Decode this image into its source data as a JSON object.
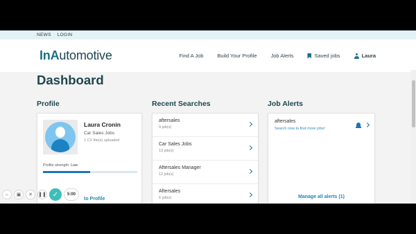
{
  "topbar": {
    "news": "NEWS",
    "login": "LOGIN"
  },
  "logo": {
    "in": "In",
    "a": "A",
    "rest": "utomotive"
  },
  "nav": {
    "find_job": "Find A Job",
    "build_profile": "Build Your Profile",
    "job_alerts": "Job Alerts",
    "saved_jobs": "Saved jobs",
    "user": "Laura"
  },
  "page_title": "Dashboard",
  "profile": {
    "heading": "Profile",
    "name": "Laura Cronin",
    "job": "Car Sales Jobs",
    "cv": "1 CV file(s) uploaded",
    "strength_label": "Profile strength:",
    "strength_value": "Low",
    "strength_fraction": 0.5,
    "go_link": "to Profile"
  },
  "searches": {
    "heading": "Recent Searches",
    "items": [
      {
        "title": "aftersales",
        "count": "9 job(s)"
      },
      {
        "title": "Car Sales Jobs",
        "count": "13 job(s)"
      },
      {
        "title": "Aftersales Manager",
        "count": "12 job(s)"
      },
      {
        "title": "Aftersales",
        "count": "6 job(s)"
      }
    ]
  },
  "alerts": {
    "heading": "Job Alerts",
    "item_title": "aftersales",
    "item_sub": "Search now to find more jobs!",
    "manage": "Manage all alerts (1)"
  },
  "recorder": {
    "time": "5:00"
  },
  "icons": [
    "bookmark-icon",
    "user-icon",
    "bell-icon",
    "chevron-right-icon",
    "avatar-icon"
  ],
  "colors": {
    "brand": "#20464f",
    "accent": "#1e87b5",
    "topbar": "#e2f2f6"
  }
}
